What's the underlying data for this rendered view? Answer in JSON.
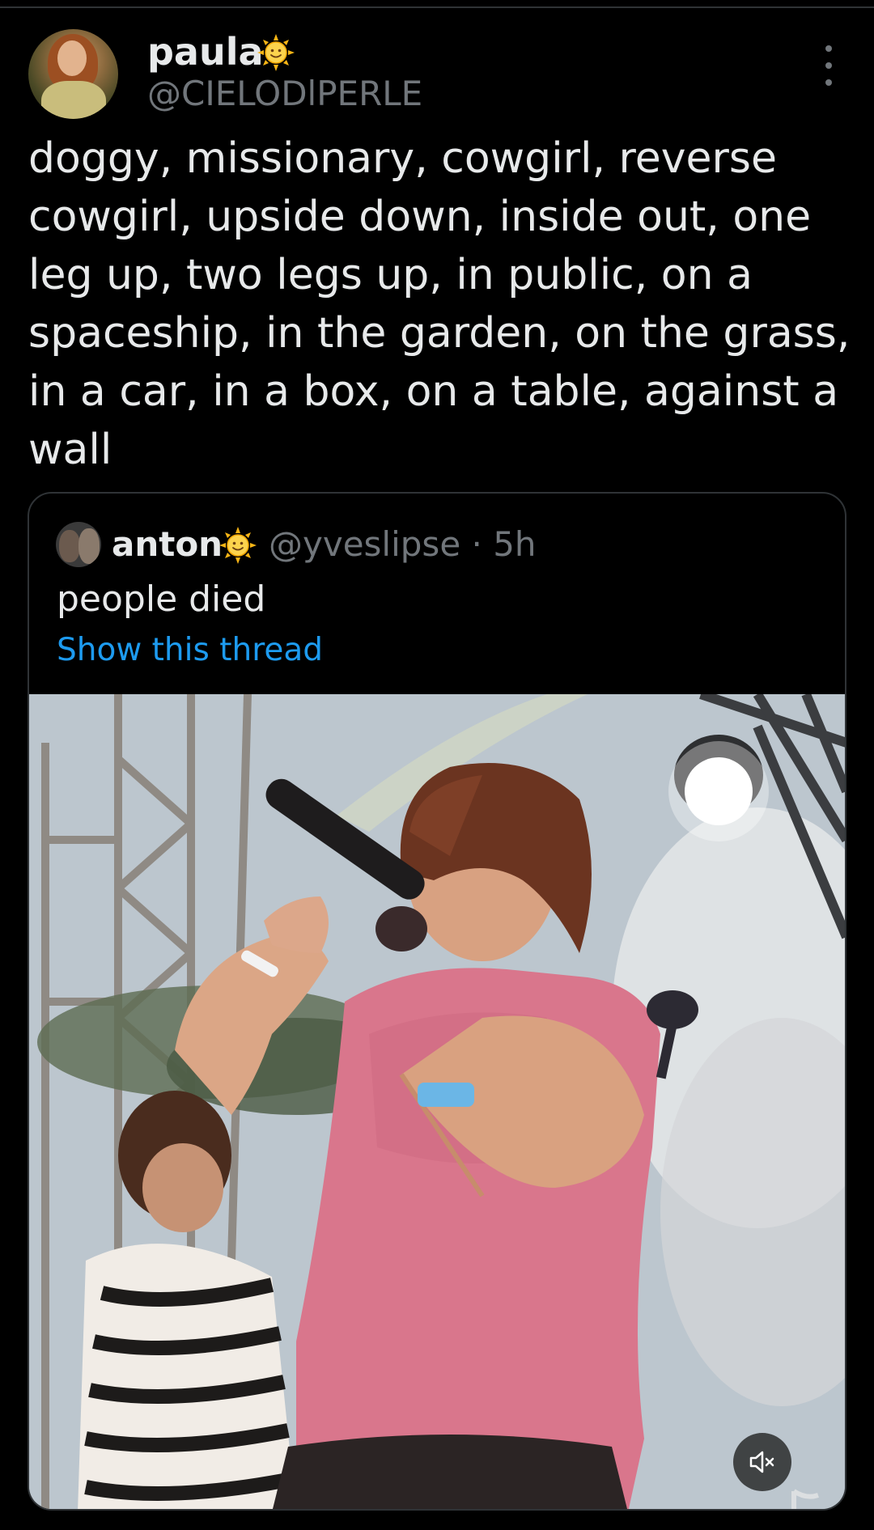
{
  "tweet": {
    "author": {
      "display_name": "paula",
      "name_emoji": "sun-face-icon",
      "handle": "@CIELODlPERLE"
    },
    "more_icon": "more-vertical-icon",
    "text": "doggy, missionary, cowgirl, reverse\ncowgirl, upside down, inside out, one\nleg up, two legs up, in public, on a\nspaceship, in the garden, on the grass,\nin a car, in a box, on a table, against a\nwall"
  },
  "quoted_tweet": {
    "author": {
      "display_name": "anton",
      "name_emoji": "sun-face-icon"
    },
    "meta": "@yveslipse · 5h",
    "text": "people died",
    "thread_link": "Show this thread",
    "media": {
      "type": "video",
      "mute_icon": "speaker-muted-icon"
    }
  },
  "colors": {
    "background": "#000000",
    "text_primary": "#e7e9ea",
    "text_secondary": "#71767b",
    "link": "#1d9bf0",
    "border": "#2f3336"
  }
}
